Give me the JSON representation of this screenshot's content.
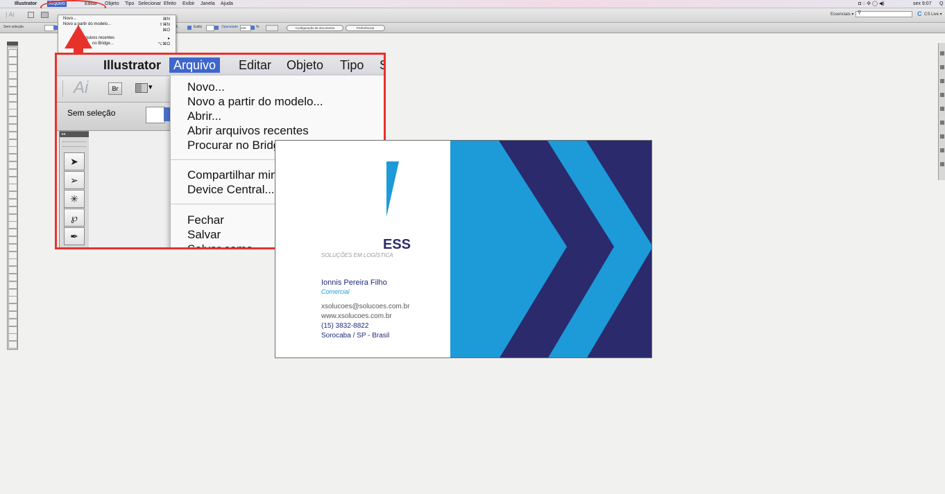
{
  "menubar": {
    "items": [
      "Illustrator",
      "Arquivo",
      "Editar",
      "Objeto",
      "Tipo",
      "Selecionar",
      "Efeito",
      "Exibir",
      "Janela",
      "Ajuda"
    ],
    "clock": "sex 9:07"
  },
  "appbar": {
    "workspace": "Essenciais ▾",
    "cs_live": "CS Live ▾"
  },
  "controlbar": {
    "selection": "Sem seleção",
    "style_label": "Estilo",
    "opacity_label": "Opacidade",
    "opacity_value": "100",
    "doc_setup_button": "Configuração de documento",
    "preferences_button": "Preferências"
  },
  "small_menu": {
    "items": [
      {
        "label": "Novo...",
        "shortcut": "⌘N"
      },
      {
        "label": "Novo a partir do modelo...",
        "shortcut": "⇧⌘N"
      },
      {
        "label": "",
        "shortcut": "⌘O"
      },
      {
        "label": "rquivos recentes",
        "shortcut": "▸"
      },
      {
        "label": "no Bridge...",
        "shortcut": "⌥⌘O"
      }
    ]
  },
  "zoom_view": {
    "menubar": [
      "Illustrator",
      "Arquivo",
      "Editar",
      "Objeto",
      "Tipo",
      "S"
    ],
    "app_logo": "Ai",
    "bridge_button": "Br",
    "selection": "Sem seleção",
    "menu_items": [
      "Novo...",
      "Novo a partir do modelo...",
      "Abrir...",
      "Abrir arquivos recentes",
      "Procurar no Bridge...",
      "Compartilhar minha tela...",
      "Device Central...",
      "Fechar",
      "Salvar",
      "Salvar como..."
    ]
  },
  "card": {
    "brand_fragment": "ESS",
    "tagline": "SOLUÇÕES EM LOGÍSTICA",
    "name": "Ionnis Pereira Filho",
    "role": "Comercial",
    "email": "xsolucoes@solucoes.com.br",
    "website": "www.xsolucoes.com.br",
    "phone": "(15) 3832-8822",
    "city": "Sorocaba / SP - Brasil",
    "colors": {
      "navy": "#2b2a6d",
      "blue": "#1d9ad8",
      "text_blue": "#1f2a7a"
    }
  },
  "annotation_color": "#e6322b"
}
